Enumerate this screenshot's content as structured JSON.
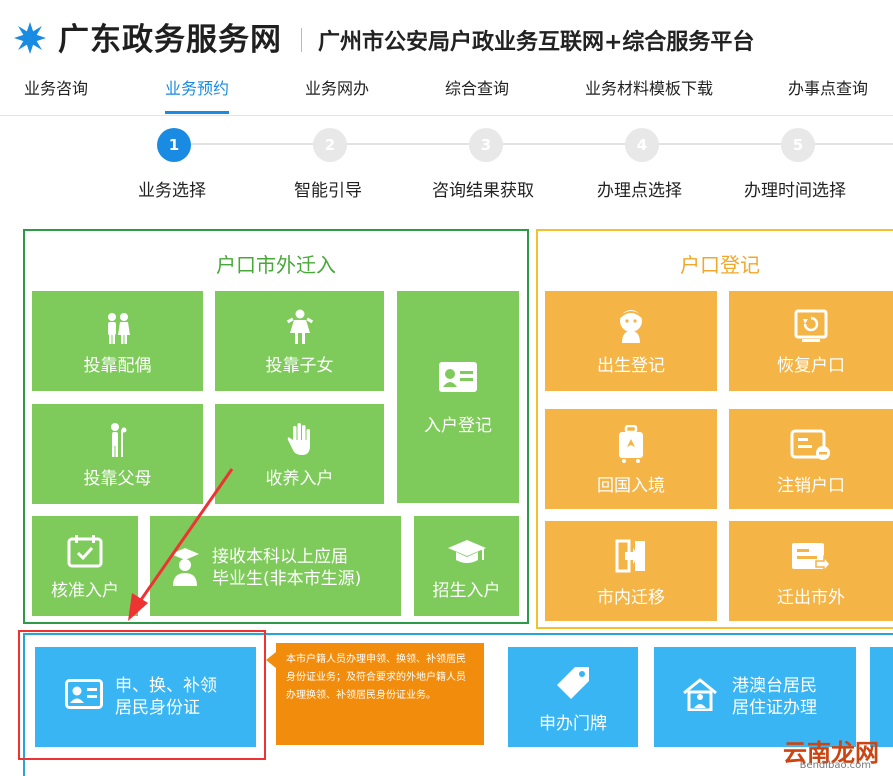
{
  "header": {
    "site_name": "广东政务服务网",
    "subtitle": "广州市公安局户政业务互联网+综合服务平台"
  },
  "nav": [
    {
      "label": "业务咨询"
    },
    {
      "label": "业务预约",
      "active": true
    },
    {
      "label": "业务网办"
    },
    {
      "label": "综合查询"
    },
    {
      "label": "业务材料模板下载"
    },
    {
      "label": "办事点查询"
    }
  ],
  "steps": [
    {
      "num": "1",
      "label": "业务选择",
      "active": true
    },
    {
      "num": "2",
      "label": "智能引导"
    },
    {
      "num": "3",
      "label": "咨询结果获取"
    },
    {
      "num": "4",
      "label": "办理点选择"
    },
    {
      "num": "5",
      "label": "办理时间选择"
    }
  ],
  "panels": {
    "green": {
      "title": "户口市外迁入",
      "tiles": [
        {
          "label": "投靠配偶",
          "icon": "couple-icon"
        },
        {
          "label": "投靠子女",
          "icon": "children-icon"
        },
        {
          "label": "入户登记",
          "icon": "id-card-icon"
        },
        {
          "label": "投靠父母",
          "icon": "parent-icon"
        },
        {
          "label": "收养入户",
          "icon": "hand-icon"
        },
        {
          "label": "核准入户",
          "icon": "calendar-check-icon"
        },
        {
          "label_line1": "接收本科以上应届",
          "label_line2": "毕业生(非本市生源)",
          "icon": "graduate-icon"
        },
        {
          "label": "招生入户",
          "icon": "mortarboard-icon"
        }
      ]
    },
    "orange": {
      "title": "户口登记",
      "tiles": [
        {
          "label": "出生登记",
          "icon": "baby-icon"
        },
        {
          "label": "恢复户口",
          "icon": "restore-icon"
        },
        {
          "label": "回国入境",
          "icon": "luggage-icon"
        },
        {
          "label": "注销户口",
          "icon": "cancel-card-icon"
        },
        {
          "label": "市内迁移",
          "icon": "move-icon"
        },
        {
          "label": "迁出市外",
          "icon": "move-out-icon"
        }
      ]
    },
    "blue": {
      "tiles": [
        {
          "label_line1": "申、换、补领",
          "label_line2": "居民身份证",
          "icon": "id-card-icon"
        },
        {
          "label": "申办门牌",
          "icon": "tag-icon"
        },
        {
          "label_line1": "港澳台居民",
          "label_line2": "居住证办理",
          "icon": "house-person-icon"
        }
      ]
    }
  },
  "tooltip": {
    "text": "本市户籍人员办理申领、换领、补领居民身份证业务；及符合要求的外地户籍人员办理换领、补领居民身份证业务。"
  },
  "watermark": {
    "text": "云南龙网",
    "sub": "Bendibao.com"
  },
  "colors": {
    "accent": "#1a8be3",
    "green_tile": "#7ecb5b",
    "orange_tile": "#f4b446",
    "blue_tile": "#38b5f2",
    "tooltip": "#f28c0c",
    "annotation": "#e33333"
  }
}
